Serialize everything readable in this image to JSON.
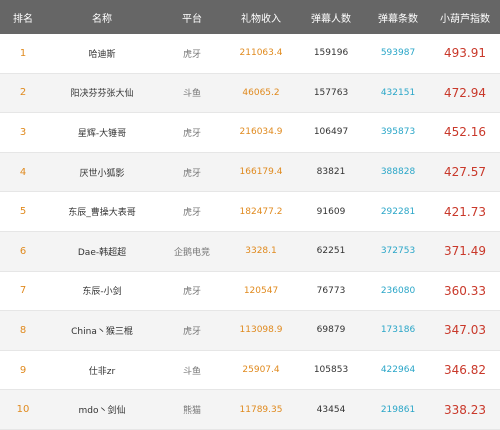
{
  "headers": [
    "排名",
    "名称",
    "平台",
    "礼物收入",
    "弹幕人数",
    "弹幕条数",
    "小葫芦指数"
  ],
  "rows": [
    {
      "rank": "1",
      "name": "哈迪斯",
      "platform": "虎牙",
      "gift": "211063.4",
      "viewers": "159196",
      "danmaku": "593987",
      "index": "493.91"
    },
    {
      "rank": "2",
      "name": "阳决芬芬张大仙",
      "platform": "斗鱼",
      "gift": "46065.2",
      "viewers": "157763",
      "danmaku": "432151",
      "index": "472.94"
    },
    {
      "rank": "3",
      "name": "星辉-大锤哥",
      "platform": "虎牙",
      "gift": "216034.9",
      "viewers": "106497",
      "danmaku": "395873",
      "index": "452.16"
    },
    {
      "rank": "4",
      "name": "厌世小狐影",
      "platform": "虎牙",
      "gift": "166179.4",
      "viewers": "83821",
      "danmaku": "388828",
      "index": "427.57"
    },
    {
      "rank": "5",
      "name": "东辰_曹操大表哥",
      "platform": "虎牙",
      "gift": "182477.2",
      "viewers": "91609",
      "danmaku": "292281",
      "index": "421.73"
    },
    {
      "rank": "6",
      "name": "Dae-韩超超",
      "platform": "企鹅电竞",
      "gift": "3328.1",
      "viewers": "62251",
      "danmaku": "372753",
      "index": "371.49"
    },
    {
      "rank": "7",
      "name": "东辰-小剑",
      "platform": "虎牙",
      "gift": "120547",
      "viewers": "76773",
      "danmaku": "236080",
      "index": "360.33"
    },
    {
      "rank": "8",
      "name": "China丶猴三棍",
      "platform": "虎牙",
      "gift": "113098.9",
      "viewers": "69879",
      "danmaku": "173186",
      "index": "347.03"
    },
    {
      "rank": "9",
      "name": "仕非zr",
      "platform": "斗鱼",
      "gift": "25907.4",
      "viewers": "105853",
      "danmaku": "422964",
      "index": "346.82"
    },
    {
      "rank": "10",
      "name": "mdo丶剑仙",
      "platform": "熊猫",
      "gift": "11789.35",
      "viewers": "43454",
      "danmaku": "219861",
      "index": "338.23"
    }
  ]
}
